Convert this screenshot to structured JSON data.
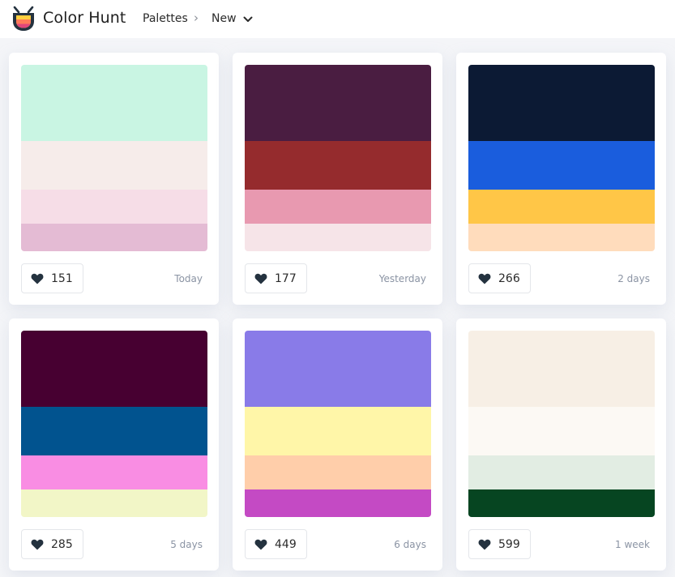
{
  "header": {
    "brand": "Color Hunt",
    "breadcrumb_palettes": "Palettes",
    "breadcrumb_separator": "›",
    "sort_label": "New"
  },
  "palettes": [
    {
      "colors": [
        "#c9f5e3",
        "#f6ecea",
        "#f6dde7",
        "#e4bbd4"
      ],
      "likes": "151",
      "date": "Today"
    },
    {
      "colors": [
        "#4a1d41",
        "#952b2d",
        "#e899b0",
        "#f6e4e8"
      ],
      "likes": "177",
      "date": "Yesterday"
    },
    {
      "colors": [
        "#0c1a34",
        "#1a5ddd",
        "#ffc647",
        "#ffdcbc"
      ],
      "likes": "266",
      "date": "2 days"
    },
    {
      "colors": [
        "#470031",
        "#01538f",
        "#f98de3",
        "#f2f6c7"
      ],
      "likes": "285",
      "date": "5 days"
    },
    {
      "colors": [
        "#897be8",
        "#fff6a8",
        "#ffceaa",
        "#c44ac4"
      ],
      "likes": "449",
      "date": "6 days"
    },
    {
      "colors": [
        "#f7efe5",
        "#fcf9f4",
        "#e2ede3",
        "#064521"
      ],
      "likes": "599",
      "date": "1 week"
    }
  ],
  "colors": {
    "logo_top": "#ffcf40",
    "logo_mid": "#ff7a59",
    "logo_bottom": "#e0467a",
    "icon_dark": "#24323f"
  }
}
